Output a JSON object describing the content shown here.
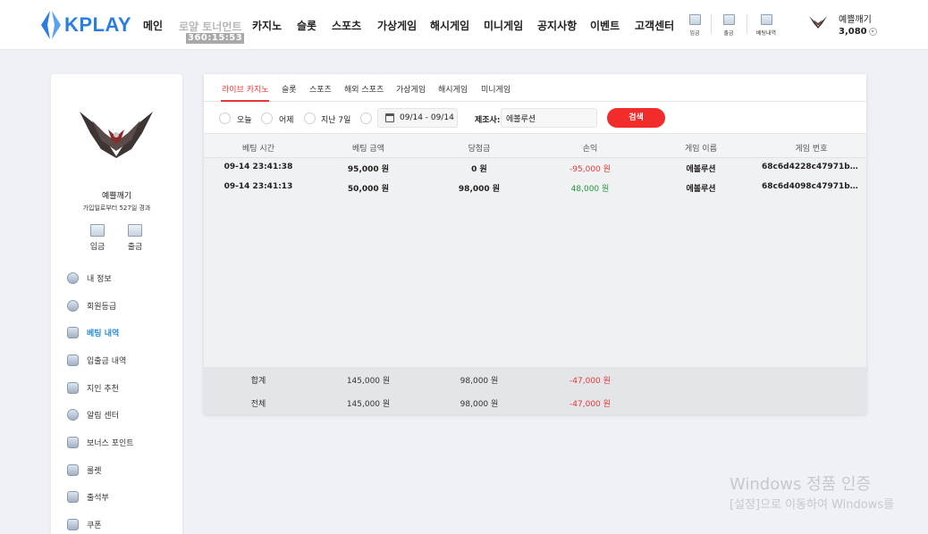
{
  "brand": {
    "name": "KPLAY",
    "color": "#2a7de1"
  },
  "nav": {
    "items": [
      "메인",
      "로얄 토너먼트",
      "카지노",
      "슬롯",
      "스포츠",
      "가상게임",
      "해시게임",
      "미니게임",
      "공지사항",
      "이벤트",
      "고객센터"
    ],
    "timer": "360:15:53"
  },
  "header_actions": [
    "입금",
    "출금",
    "베팅내역"
  ],
  "user": {
    "name": "예쁠깨기",
    "balance": "3,080"
  },
  "sidebar": {
    "name": "예쁠깨기",
    "sub": "가입일로부터 527일 경과",
    "buttons": [
      "입금",
      "출금"
    ],
    "menu": [
      "내 정보",
      "회원등급",
      "베팅 내역",
      "입출금 내역",
      "지인 추천",
      "알림 센터",
      "보너스 포인트",
      "룰렛",
      "출석부",
      "쿠폰"
    ],
    "active": "베팅 내역"
  },
  "tabs": {
    "items": [
      "라이브 카지노",
      "슬롯",
      "스포츠",
      "해외 스포츠",
      "가상게임",
      "해시게임",
      "미니게임"
    ],
    "active": "라이브 카지노"
  },
  "filters": {
    "radios": [
      "오늘",
      "어제",
      "지난 7일"
    ],
    "date_range": "09/14 - 09/14",
    "maker_label": "제조사:",
    "maker_value": "에볼루션",
    "search": "검색"
  },
  "table": {
    "headers": [
      "베팅 시간",
      "베팅 금액",
      "당첨금",
      "손익",
      "게임 이름",
      "게임 번호"
    ],
    "rows": [
      [
        "09-14 23:41:38",
        "95,000 원",
        "0 원",
        "-95,000 원",
        "에볼루션",
        "68c6d4228c47971b3f…"
      ],
      [
        "09-14 23:41:13",
        "50,000 원",
        "98,000 원",
        "48,000 원",
        "에볼루션",
        "68c6d4098c47971b3f…"
      ]
    ],
    "totals": [
      [
        "합계",
        "145,000 원",
        "98,000 원",
        "-47,000 원"
      ],
      [
        "전체",
        "145,000 원",
        "98,000 원",
        "-47,000 원"
      ]
    ]
  },
  "colors": {
    "accent": "#f22b2b",
    "loss": "#e53935",
    "gain": "#1e9a3c",
    "active_menu": "#2a8fd6"
  },
  "watermark": {
    "title": "Windows 정품 인증",
    "sub": "[설정]으로 이동하여 Windows를"
  }
}
